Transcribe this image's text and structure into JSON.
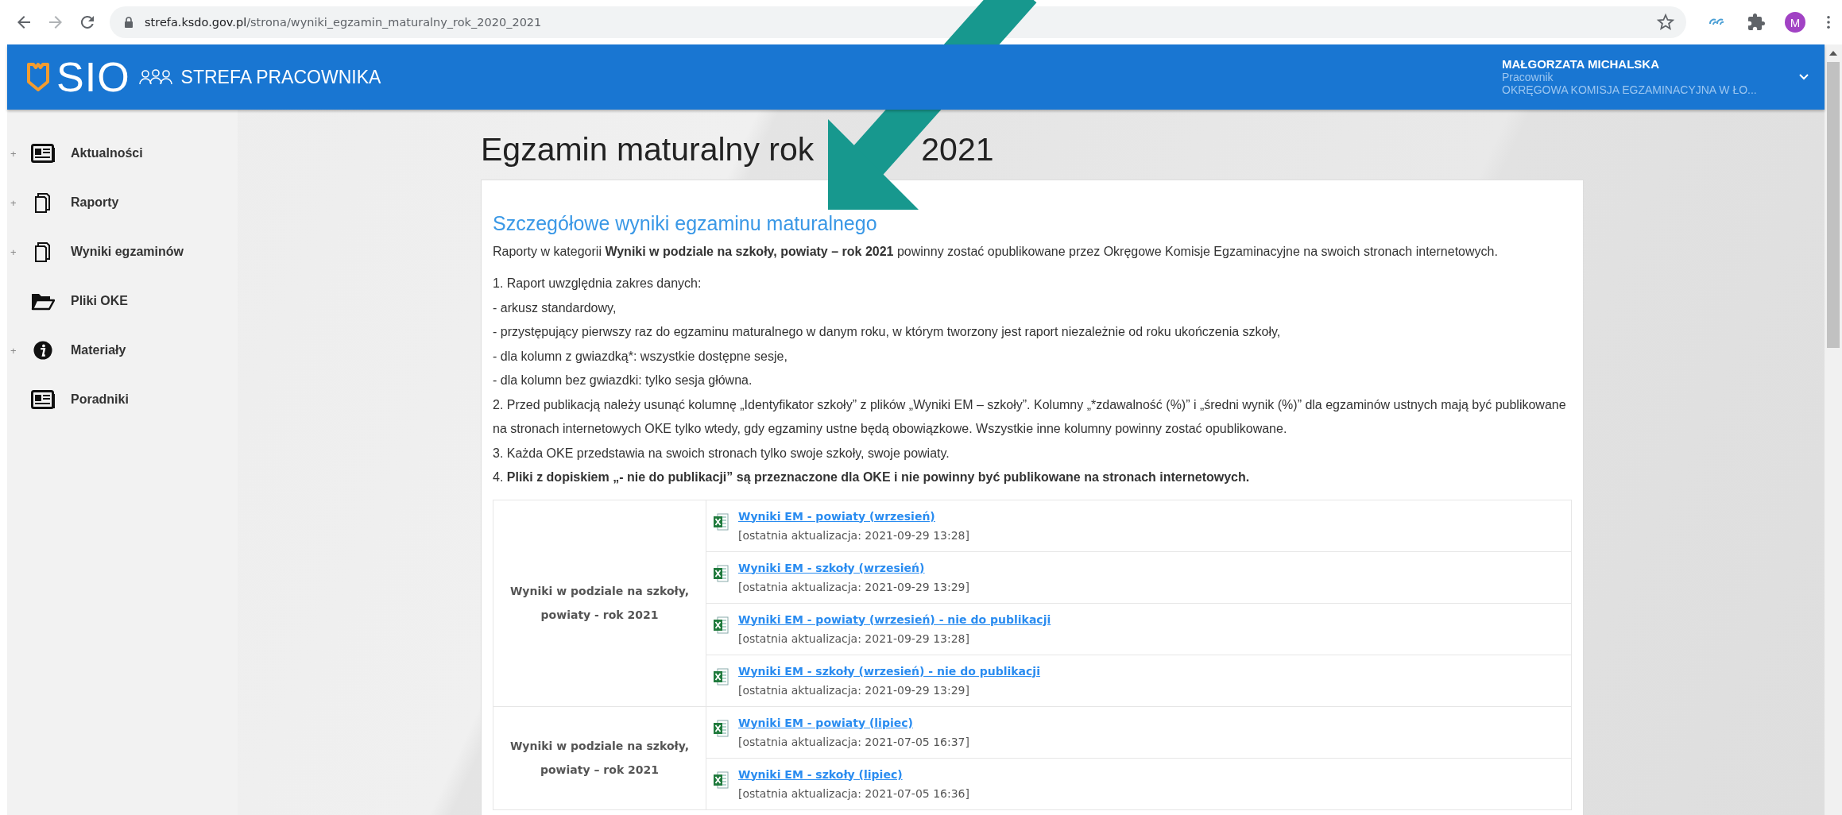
{
  "browser": {
    "url_host": "strefa.ksdo.gov.pl",
    "url_path": "/strona/wyniki_egzamin_maturalny_rok_2020_2021",
    "profile_initial": "M"
  },
  "header": {
    "logo_text": "SIO",
    "section": "STREFA PRACOWNIKA",
    "user": {
      "name": "MAŁGORZATA MICHALSKA",
      "role": "Pracownik",
      "organization": "OKRĘGOWA KOMISJA EGZAMINACYJNA W ŁO..."
    }
  },
  "sidebar": {
    "items": [
      {
        "label": "Aktualności",
        "kind": "news",
        "expander": "+"
      },
      {
        "label": "Raporty",
        "kind": "document",
        "expander": "+"
      },
      {
        "label": "Wyniki egzaminów",
        "kind": "document",
        "expander": "+"
      },
      {
        "label": "Pliki OKE",
        "kind": "folder"
      },
      {
        "label": "Materiały",
        "kind": "info",
        "expander": "+"
      },
      {
        "label": "Poradniki",
        "kind": "news"
      }
    ]
  },
  "page": {
    "title_parts": [
      "Egzamin maturalny rok",
      "2021"
    ],
    "card": {
      "heading": "Szczegółowe wyniki egzaminu maturalnego",
      "intro": "Raporty  w kategorii **Wyniki w podziale na szkoły, powiaty – rok 2021** powinny zostać opublikowane przez Okręgowe Komisje Egzaminacyjne na swoich stronach internetowych.",
      "notes": [
        "1. Raport uwzględnia zakres danych:",
        "- arkusz standardowy,",
        "- przystępujący pierwszy raz do egzaminu maturalnego w danym roku, w którym tworzony jest raport niezależnie od roku ukończenia szkoły,",
        "- dla kolumn z gwiazdką*: wszystkie dostępne sesje,",
        "- dla kolumn bez gwiazdki: tylko sesja główna.",
        "2. Przed publikacją należy usunąć kolumnę „Identyfikator szkoły” z plików  „Wyniki EM – szkoły”. Kolumny „*zdawalność (%)” i „średni wynik (%)” dla egzaminów ustnych mają być publikowane na stronach internetowych OKE tylko wtedy, gdy egzaminy ustne będą obowiązkowe. Wszystkie inne kolumny powinny zostać opublikowane.",
        "3. Każda OKE przedstawia na swoich stronach tylko swoje szkoły, swoje powiaty.",
        "4. **Pliki z dopiskiem „- nie do publikacji” są przeznaczone dla OKE i nie powinny być publikowane na stronach internetowych.**"
      ],
      "groups": [
        {
          "label": "Wyniki w podziale na szkoły, powiaty - rok 2021",
          "files": [
            {
              "name": "Wyniki EM - powiaty (wrzesień)",
              "updated": "[ostatnia aktualizacja: 2021-09-29 13:28]"
            },
            {
              "name": "Wyniki EM - szkoły (wrzesień)",
              "updated": "[ostatnia aktualizacja: 2021-09-29 13:29]"
            },
            {
              "name": "Wyniki EM - powiaty (wrzesień) - nie do publikacji",
              "updated": "[ostatnia aktualizacja: 2021-09-29 13:28]"
            },
            {
              "name": "Wyniki EM - szkoły (wrzesień) - nie do publikacji",
              "updated": "[ostatnia aktualizacja: 2021-09-29 13:29]"
            }
          ]
        },
        {
          "label": "Wyniki w podziale na szkoły, powiaty – rok 2021",
          "files": [
            {
              "name": "Wyniki EM - powiaty (lipiec)",
              "updated": "[ostatnia aktualizacja: 2021-07-05 16:37]"
            },
            {
              "name": "Wyniki EM - szkoły (lipiec)",
              "updated": "[ostatnia aktualizacja: 2021-07-05 16:36]"
            }
          ]
        }
      ]
    }
  }
}
